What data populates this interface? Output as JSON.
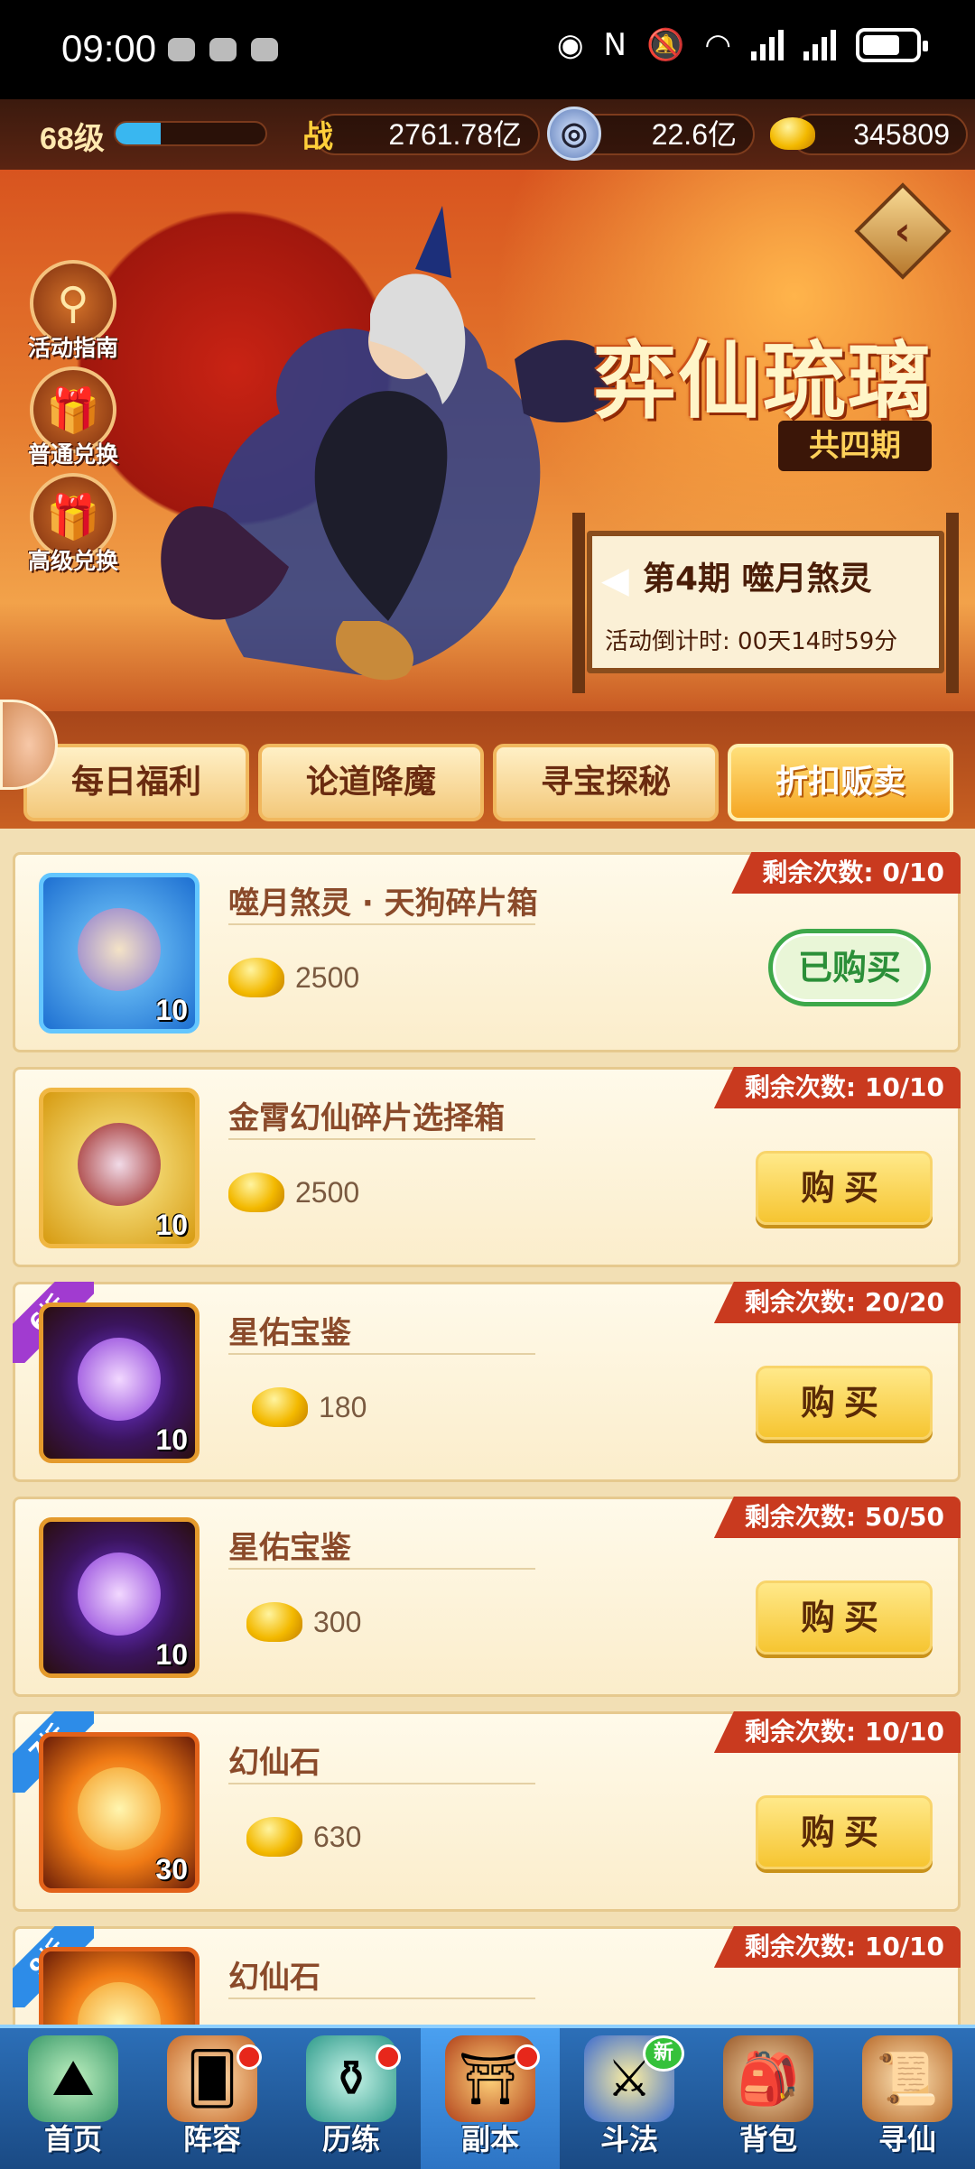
{
  "status_bar": {
    "time": "09:00"
  },
  "resources": {
    "level": "68级",
    "exp_fraction": 0.3,
    "combat_icon": "战",
    "combat_power": "2761.78亿",
    "coin": "22.6亿",
    "ingot": "345809"
  },
  "banner": {
    "title": "弈仙琉璃",
    "subtitle": "共四期",
    "side_buttons": [
      "活动指南",
      "普通兑换",
      "高级兑换"
    ],
    "period_title": "第4期  噬月煞灵",
    "countdown": "活动倒计时: 00天14时59分"
  },
  "tabs": [
    "每日福利",
    "论道降魔",
    "寻宝探秘",
    "折扣贩卖"
  ],
  "items": [
    {
      "name": "噬月煞灵 · 天狗碎片箱",
      "qty": "10",
      "price": "2500",
      "remain": "剩余次数: 0/10",
      "action": "已购买"
    },
    {
      "name": "金霄幻仙碎片选择箱",
      "qty": "10",
      "price": "2500",
      "remain": "剩余次数: 10/10",
      "action": "购买"
    },
    {
      "name": "星佑宝鉴",
      "qty": "10",
      "price": "180",
      "remain": "剩余次数: 20/20",
      "action": "购买",
      "discount": "6折"
    },
    {
      "name": "星佑宝鉴",
      "qty": "10",
      "price": "300",
      "remain": "剩余次数: 50/50",
      "action": "购买"
    },
    {
      "name": "幻仙石",
      "qty": "30",
      "price": "630",
      "remain": "剩余次数: 10/10",
      "action": "购买",
      "discount": "7折"
    },
    {
      "name": "幻仙石",
      "qty": "",
      "price": "",
      "remain": "剩余次数: 10/10",
      "action": "",
      "discount": "9折"
    }
  ],
  "bottom_nav": [
    "首页",
    "阵容",
    "历练",
    "副本",
    "斗法",
    "背包",
    "寻仙"
  ],
  "bottom_nav_badge_new": "新",
  "colors": {
    "accent_red": "#c93a1f",
    "buy_gold": "#f6c531",
    "bought_green": "#3da84a",
    "nav_blue": "#2c6fb8"
  }
}
